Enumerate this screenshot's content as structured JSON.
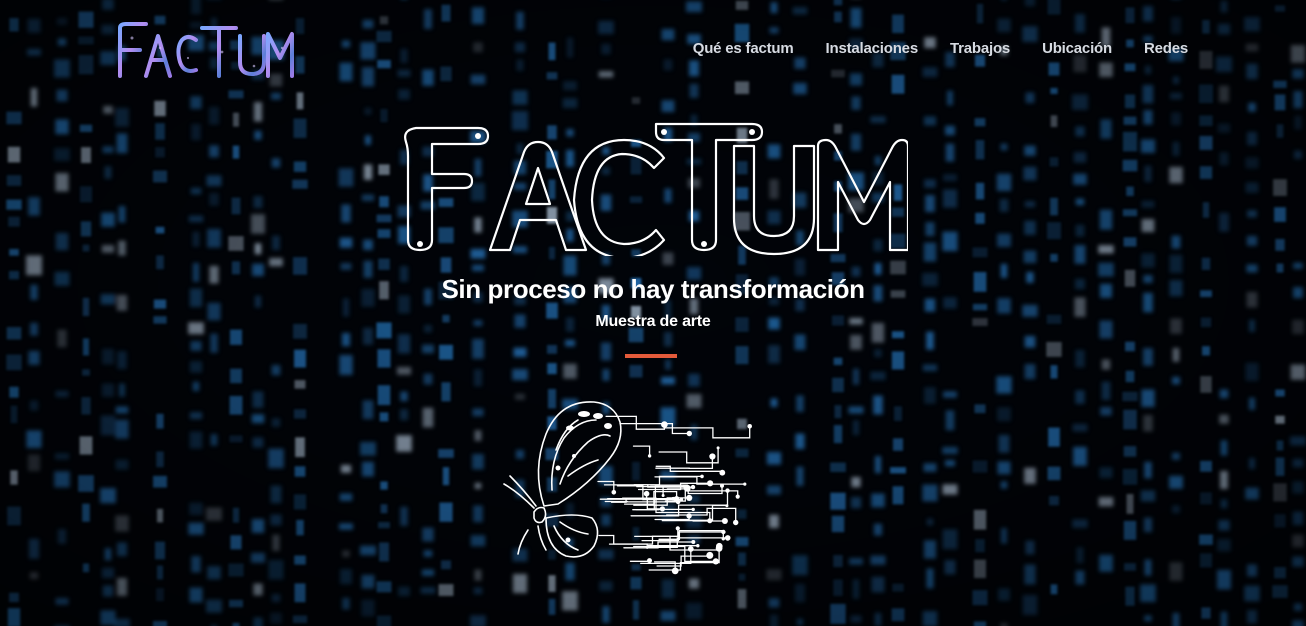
{
  "brand": {
    "logo_text": "FACTUM",
    "logo_icon": "factum-wordmark"
  },
  "nav": {
    "items": [
      "Qué es factum",
      "Instalaciones",
      "Trabajos",
      "Ubicación",
      "Redes"
    ]
  },
  "hero": {
    "title_text": "FACTUM",
    "tagline": "Sin proceso no hay transformación",
    "subtitle": "Muestra de arte",
    "divider_color": "#e35a3a",
    "illustration": "butterfly-circuit-icon"
  },
  "theme": {
    "background": "#02050b",
    "code_rain": "#2e8fe6",
    "nav_text": "#d7dbe2"
  }
}
